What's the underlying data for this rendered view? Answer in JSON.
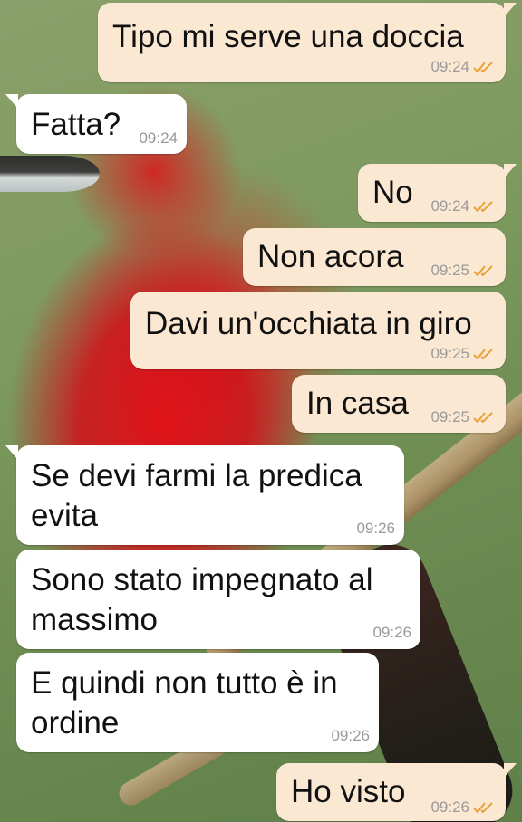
{
  "colors": {
    "outgoing_bubble": "#fbe8d3",
    "incoming_bubble": "#ffffff",
    "read_ticks": "#e8a23a",
    "timestamp": "#9a9a9a"
  },
  "messages": [
    {
      "direction": "out",
      "text": "Tipo mi serve una doccia",
      "time": "09:24",
      "status": "read-ticks-icon"
    },
    {
      "direction": "in",
      "text": "Fatta?",
      "time": "09:24"
    },
    {
      "direction": "out",
      "text": "No",
      "time": "09:24",
      "status": "read-ticks-icon"
    },
    {
      "direction": "out",
      "text": "Non acora",
      "time": "09:25",
      "status": "read-ticks-icon"
    },
    {
      "direction": "out",
      "text": "Davi un'occhiata in giro",
      "time": "09:25",
      "status": "read-ticks-icon"
    },
    {
      "direction": "out",
      "text": "In casa",
      "time": "09:25",
      "status": "read-ticks-icon"
    },
    {
      "direction": "in",
      "text_line1": "Se devi farmi la predica",
      "text_line2": "evita",
      "time": "09:26"
    },
    {
      "direction": "in",
      "text_line1": "Sono stato impegnato al",
      "text_line2": "massimo",
      "time": "09:26"
    },
    {
      "direction": "in",
      "text_line1": "E quindi non tutto è in",
      "text_line2": "ordine",
      "time": "09:26"
    },
    {
      "direction": "out",
      "text": "Ho visto",
      "time": "09:26",
      "status": "read-ticks-icon"
    }
  ]
}
